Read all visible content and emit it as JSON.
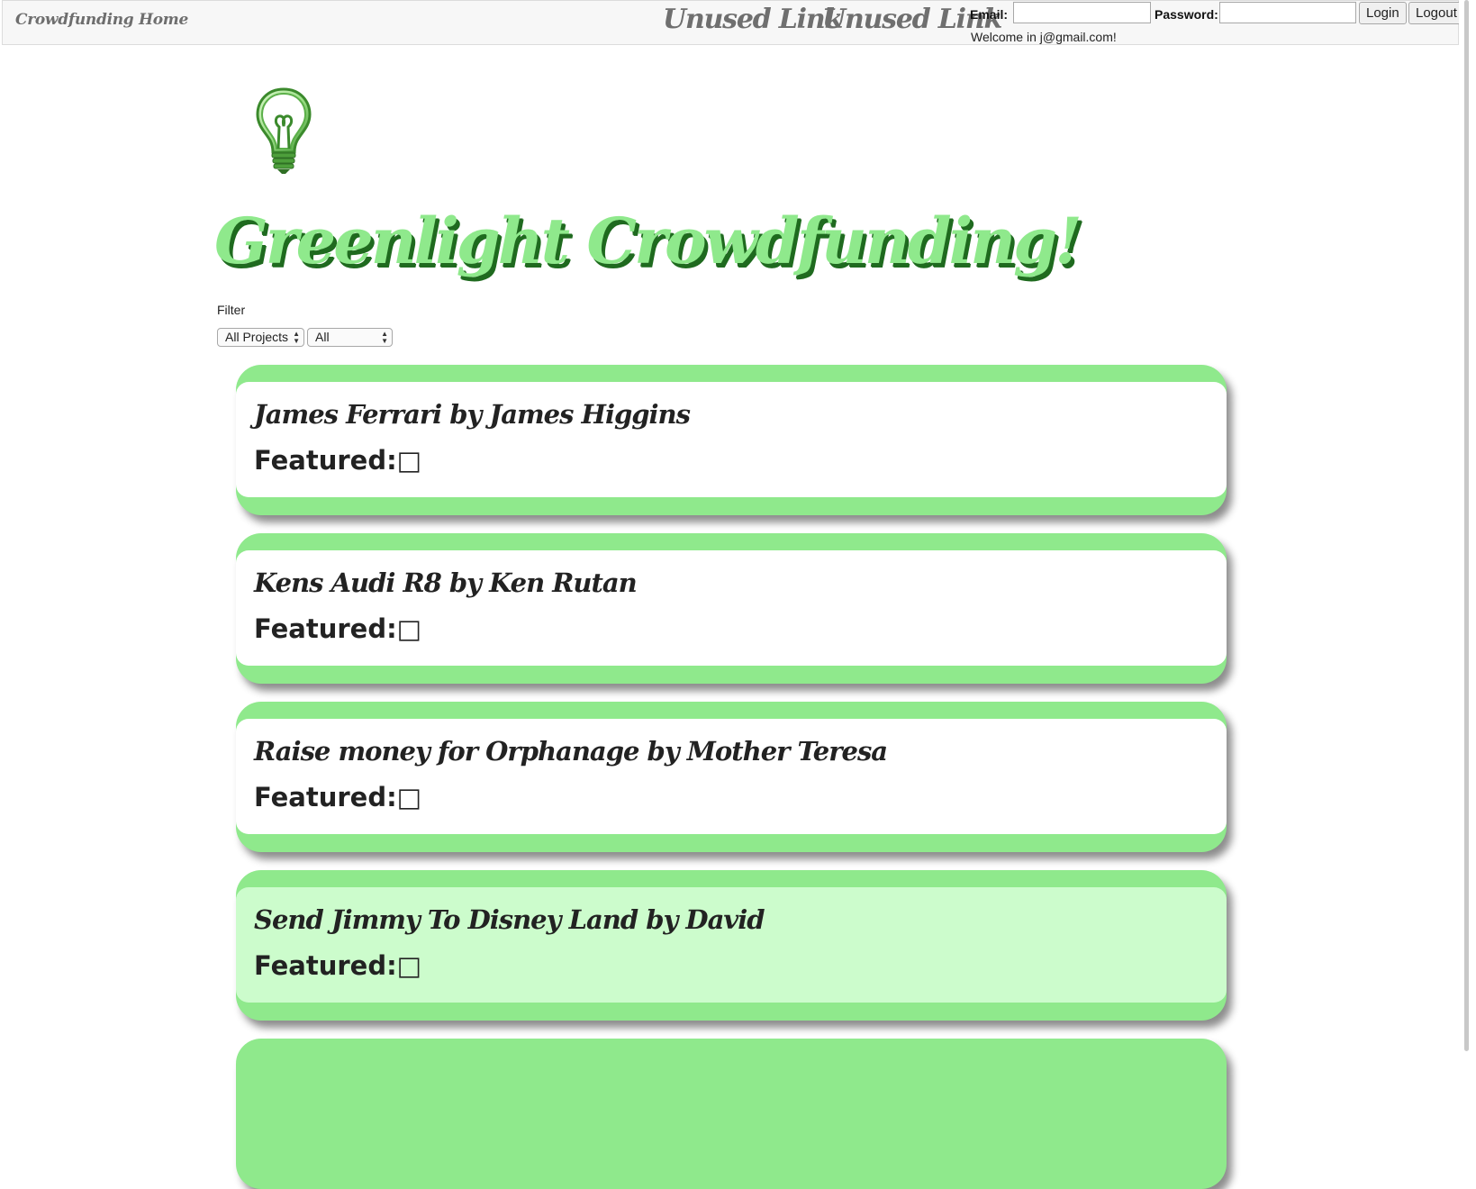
{
  "navbar": {
    "brand": "Crowdfunding Home",
    "links": [
      "Unused Link",
      "Unused Link"
    ],
    "email_label": "Email:",
    "email_value": "",
    "password_label": "Password:",
    "password_value": "",
    "login_label": "Login",
    "logout_label": "Logout",
    "welcome": "Welcome in j@gmail.com!"
  },
  "header": {
    "logo_icon": "lightbulb-icon",
    "title": "Greenlight Crowdfunding!"
  },
  "filter": {
    "label": "Filter",
    "type_selected": "All Projects",
    "category_selected": "All"
  },
  "colors": {
    "accent_green": "#8fe98c",
    "highlight_row": "#ccfccc",
    "headline_shadow": "#1f6a1f"
  },
  "projects": [
    {
      "title": "James Ferrari by James Higgins",
      "featured_label": "Featured:",
      "featured_box": "□",
      "highlighted": false
    },
    {
      "title": "Kens Audi R8 by Ken Rutan",
      "featured_label": "Featured:",
      "featured_box": "□",
      "highlighted": false
    },
    {
      "title": "Raise money for Orphanage by Mother Teresa",
      "featured_label": "Featured:",
      "featured_box": "□",
      "highlighted": false
    },
    {
      "title": "Send Jimmy To Disney Land by David",
      "featured_label": "Featured:",
      "featured_box": "□",
      "highlighted": true
    }
  ]
}
